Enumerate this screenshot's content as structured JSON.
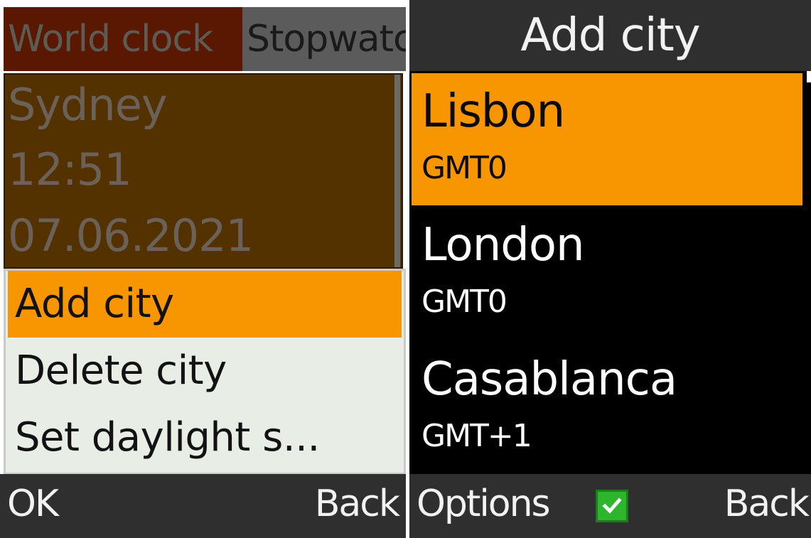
{
  "left_screen": {
    "tabs": [
      {
        "label": "World clock",
        "active": true
      },
      {
        "label": "Stopwatch",
        "active": false
      }
    ],
    "clock": {
      "city": "Sydney",
      "time": "12:51",
      "date": "07.06.2021"
    },
    "menu": {
      "items": [
        {
          "label": "Add city",
          "selected": true
        },
        {
          "label": "Delete city",
          "selected": false
        },
        {
          "label": "Set daylight s...",
          "selected": false
        }
      ]
    },
    "softkeys": {
      "left": "OK",
      "right": "Back"
    }
  },
  "right_screen": {
    "title": "Add city",
    "cities": [
      {
        "name": "Lisbon",
        "timezone": "GMT0",
        "selected": true
      },
      {
        "name": "London",
        "timezone": "GMT0",
        "selected": false
      },
      {
        "name": "Casablanca",
        "timezone": "GMT+1",
        "selected": false
      }
    ],
    "softkeys": {
      "left": "Options",
      "center_icon": "check-icon",
      "right": "Back"
    }
  },
  "colors": {
    "selection": "#f79600",
    "active_tab": "#5a1800",
    "clock_panel": "#543200",
    "softkey_bar": "#2f2f2f",
    "check": "#2db52d"
  }
}
